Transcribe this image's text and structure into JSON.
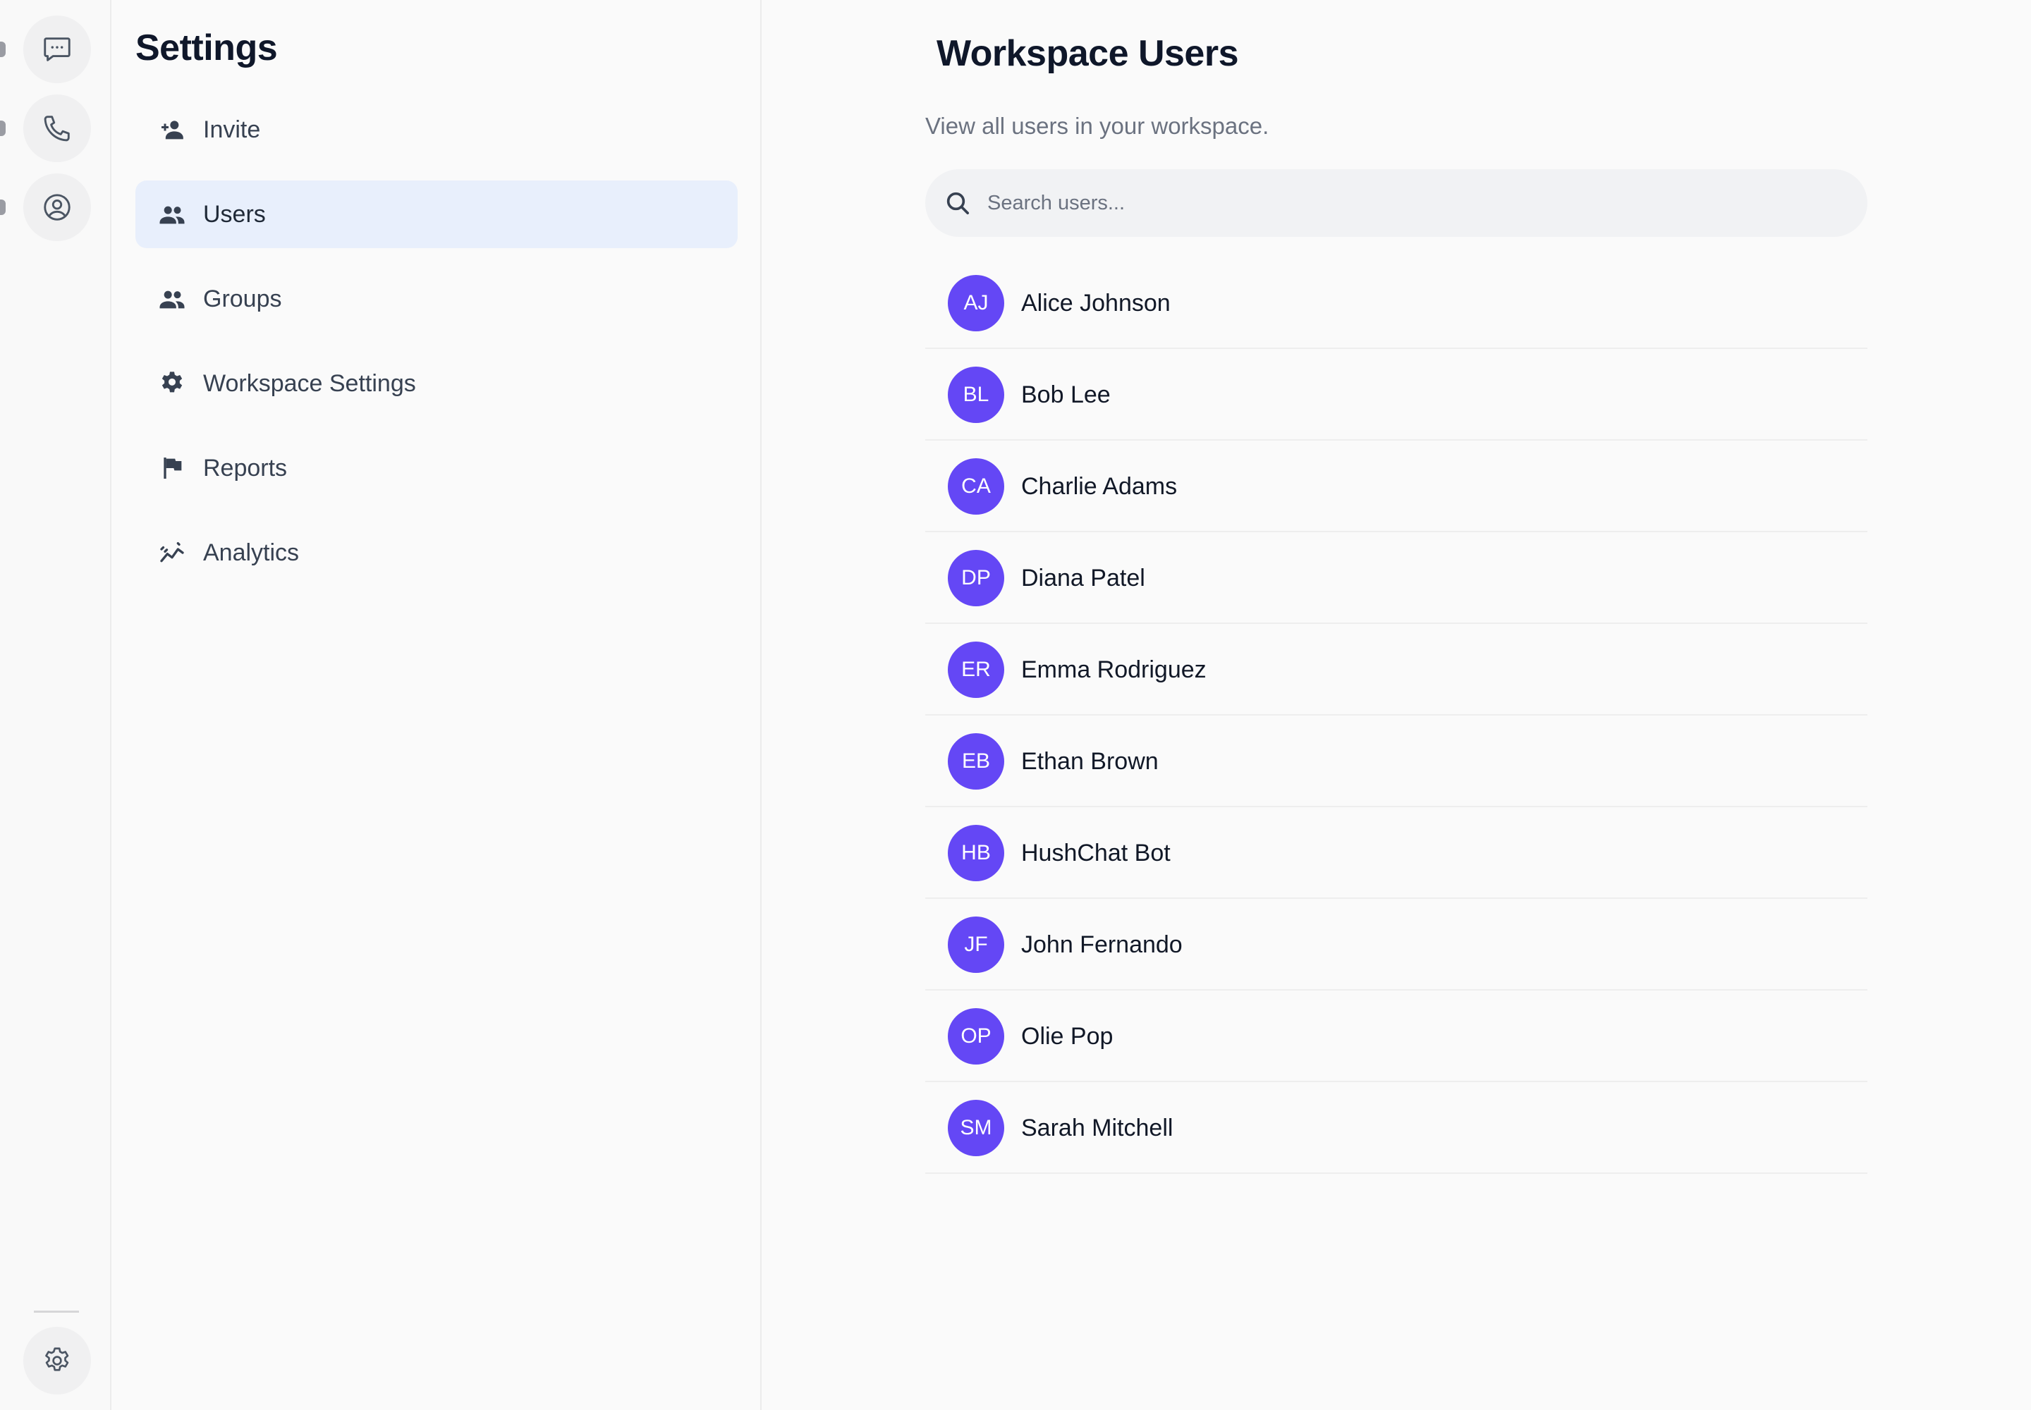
{
  "colors": {
    "accent": "#6447f5",
    "active_nav_bg": "#e8effc",
    "icon": "#374151"
  },
  "rail": {
    "items": [
      {
        "icon": "chat-bubble-icon"
      },
      {
        "icon": "phone-icon"
      },
      {
        "icon": "user-circle-icon"
      }
    ],
    "bottom_icon": "gear-icon"
  },
  "sidebar": {
    "title": "Settings",
    "items": [
      {
        "label": "Invite",
        "icon": "person-add-icon",
        "active": false
      },
      {
        "label": "Users",
        "icon": "people-icon",
        "active": true
      },
      {
        "label": "Groups",
        "icon": "people-icon",
        "active": false
      },
      {
        "label": "Workspace Settings",
        "icon": "gear-icon",
        "active": false
      },
      {
        "label": "Reports",
        "icon": "flag-icon",
        "active": false
      },
      {
        "label": "Analytics",
        "icon": "analytics-icon",
        "active": false
      }
    ]
  },
  "main": {
    "title": "Workspace Users",
    "subtitle": "View all users in your workspace.",
    "search": {
      "placeholder": "Search users...",
      "value": ""
    },
    "users": [
      {
        "initials": "AJ",
        "name": "Alice Johnson"
      },
      {
        "initials": "BL",
        "name": "Bob Lee"
      },
      {
        "initials": "CA",
        "name": "Charlie Adams"
      },
      {
        "initials": "DP",
        "name": "Diana Patel"
      },
      {
        "initials": "ER",
        "name": "Emma Rodriguez"
      },
      {
        "initials": "EB",
        "name": "Ethan Brown"
      },
      {
        "initials": "HB",
        "name": "HushChat Bot"
      },
      {
        "initials": "JF",
        "name": "John Fernando"
      },
      {
        "initials": "OP",
        "name": "Olie Pop"
      },
      {
        "initials": "SM",
        "name": "Sarah Mitchell"
      }
    ]
  }
}
